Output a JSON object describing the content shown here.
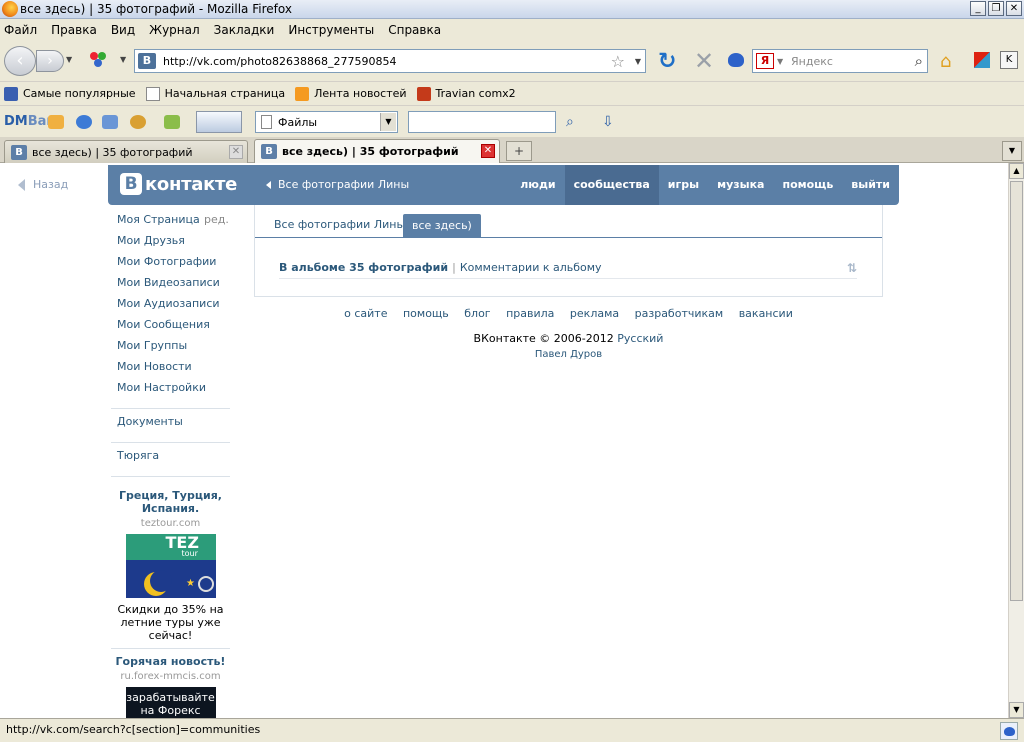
{
  "window": {
    "title": "все здесь) | 35 фотографий - Mozilla Firefox",
    "min": "_",
    "max": "❐",
    "close": "✕"
  },
  "menu": [
    "Файл",
    "Правка",
    "Вид",
    "Журнал",
    "Закладки",
    "Инструменты",
    "Справка"
  ],
  "navbar": {
    "url": "http://vk.com/photo82638868_277590854",
    "favicon": "B",
    "search_engine": "Я",
    "search_placeholder": "Яндекс"
  },
  "bookmarks": [
    {
      "label": "Самые популярные",
      "icon": "popular-icon"
    },
    {
      "label": "Начальная страница",
      "icon": "page-icon"
    },
    {
      "label": "Лента новостей",
      "icon": "rss-icon"
    },
    {
      "label": "Travian comx2",
      "icon": "travian-icon"
    }
  ],
  "dmbar": {
    "logo_a": "DM",
    "logo_b": "Bar",
    "select_value": "Файлы",
    "field_value": ""
  },
  "tabs": [
    {
      "label": "все здесь) | 35 фотографий",
      "favicon": "B",
      "active": false
    },
    {
      "label": "все здесь) | 35 фотографий",
      "favicon": "B",
      "active": true
    }
  ],
  "tab_new": "+",
  "page": {
    "back": "Назад",
    "logo_letter": "В",
    "logo_text": "контакте",
    "crumb": "Все фотографии Лины",
    "topnav": [
      {
        "label": "люди",
        "active": false
      },
      {
        "label": "сообщества",
        "active": true
      },
      {
        "label": "игры",
        "active": false
      },
      {
        "label": "музыка",
        "active": false
      },
      {
        "label": "помощь",
        "active": false
      },
      {
        "label": "выйти",
        "active": false
      }
    ],
    "leftnav": [
      "Моя Страница",
      "Мои Друзья",
      "Мои Фотографии",
      "Мои Видеозаписи",
      "Мои Аудиозаписи",
      "Мои Сообщения",
      "Мои Группы",
      "Мои Новости",
      "Мои Настройки"
    ],
    "edit": "ред.",
    "extra_nav": [
      "Документы",
      "Тюряга"
    ],
    "ad1": {
      "title": "Греция, Турция, Испания.",
      "domain": "teztour.com",
      "image_text": "TEZ",
      "image_sub": "tour",
      "desc": "Скидки до 35% на летние туры уже сейчас!"
    },
    "ad2": {
      "title": "Горячая новость!",
      "domain": "ru.forex-mmcis.com",
      "image_text": "зарабатывайте на Форекс"
    },
    "content_tabs": [
      "Все фотографии Лины",
      "все здесь)"
    ],
    "album_count": "В альбоме 35 фотографий",
    "comments_link": "Комментарии к альбому",
    "sort": "⇅",
    "footer_links": [
      "о сайте",
      "помощь",
      "блог",
      "правила",
      "реклама",
      "разработчикам",
      "вакансии"
    ],
    "copyright": "ВКонтакте © 2006-2012",
    "language": "Русский",
    "author": "Павел Дуров"
  },
  "status": "http://vk.com/search?c[section]=communities"
}
